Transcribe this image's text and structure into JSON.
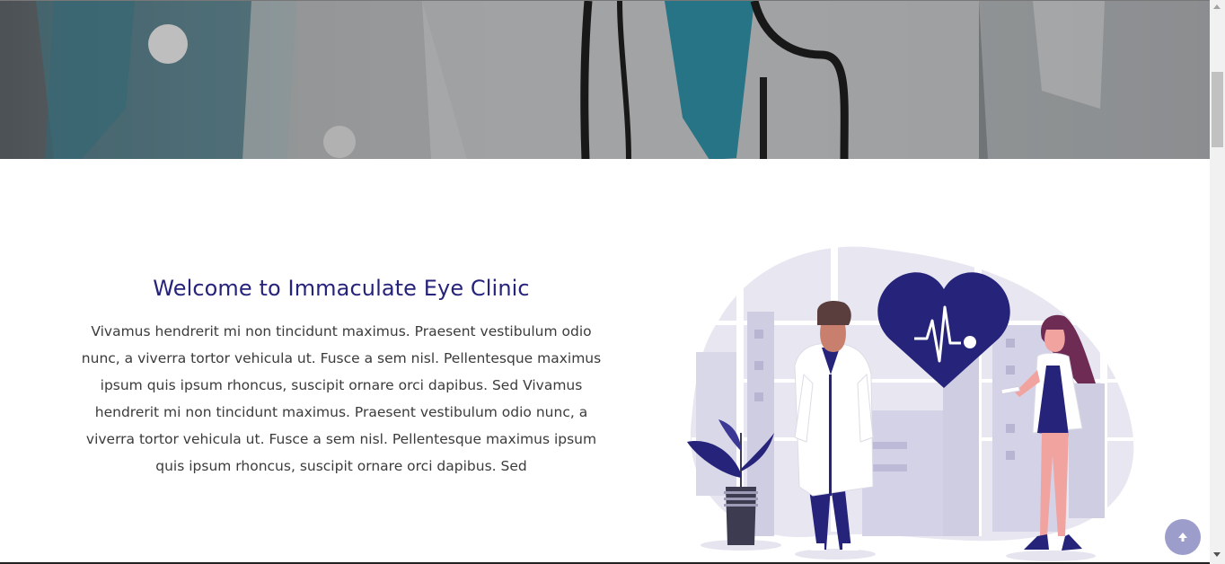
{
  "welcome": {
    "title": "Welcome to Immaculate Eye Clinic",
    "lines": [
      "Vivamus hendrerit mi non tincidunt maximus. Praesent vestibulum odio",
      "nunc, a viverra tortor vehicula ut. Fusce a sem nisl. Pellentesque maximus",
      "ipsum quis ipsum rhoncus, suscipit ornare orci dapibus. Sed Vivamus",
      "hendrerit mi non tincidunt maximus. Praesent vestibulum odio nunc, a",
      "viverra tortor vehicula ut. Fusce a sem nisl. Pellentesque maximus ipsum",
      "quis ipsum rhoncus, suscipit ornare orci dapibus. Sed"
    ]
  },
  "icons": {
    "back_to_top": "arrow-up-icon",
    "illustration": "doctors-heart-illustration"
  },
  "colors": {
    "title": "#26237a",
    "accent": "#26237a",
    "button": "#9d9dcc"
  }
}
